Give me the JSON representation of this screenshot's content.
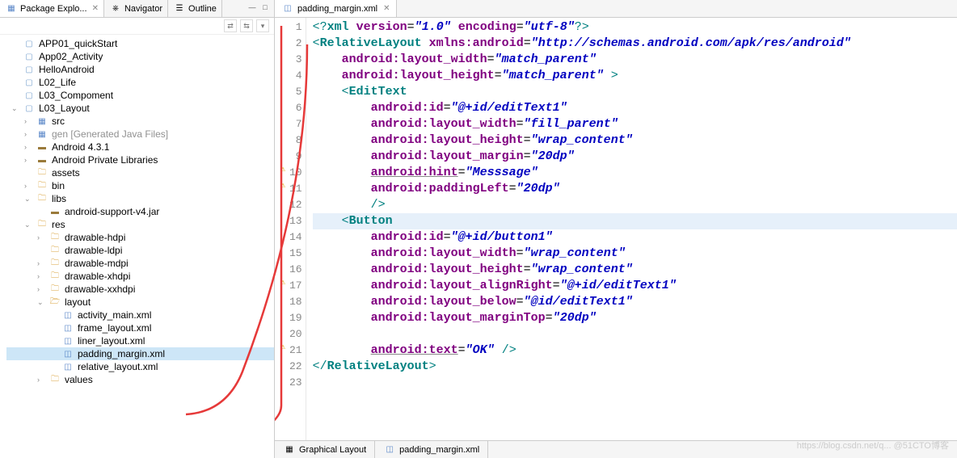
{
  "sideTabs": {
    "active": "Package Explo...",
    "tab2": "Navigator",
    "tab3": "Outline"
  },
  "tree": {
    "items": [
      {
        "ind": 0,
        "arrow": "",
        "icon": "proj",
        "label": "APP01_quickStart"
      },
      {
        "ind": 0,
        "arrow": "",
        "icon": "proj",
        "label": "App02_Activity"
      },
      {
        "ind": 0,
        "arrow": "",
        "icon": "proj",
        "label": "HelloAndroid"
      },
      {
        "ind": 0,
        "arrow": "",
        "icon": "proj",
        "label": "L02_Life"
      },
      {
        "ind": 0,
        "arrow": "",
        "icon": "proj",
        "label": "L03_Compoment"
      },
      {
        "ind": 0,
        "arrow": "v",
        "icon": "proj",
        "label": "L03_Layout"
      },
      {
        "ind": 1,
        "arrow": ">",
        "icon": "package",
        "label": "src"
      },
      {
        "ind": 1,
        "arrow": ">",
        "icon": "package",
        "label": "gen [Generated Java Files]",
        "gray": true
      },
      {
        "ind": 1,
        "arrow": ">",
        "icon": "jar",
        "label": "Android 4.3.1"
      },
      {
        "ind": 1,
        "arrow": ">",
        "icon": "jar",
        "label": "Android Private Libraries"
      },
      {
        "ind": 1,
        "arrow": "",
        "icon": "folder",
        "label": "assets"
      },
      {
        "ind": 1,
        "arrow": ">",
        "icon": "folder",
        "label": "bin"
      },
      {
        "ind": 1,
        "arrow": "v",
        "icon": "folder",
        "label": "libs"
      },
      {
        "ind": 2,
        "arrow": "",
        "icon": "jar",
        "label": "android-support-v4.jar"
      },
      {
        "ind": 1,
        "arrow": "v",
        "icon": "folder",
        "label": "res"
      },
      {
        "ind": 2,
        "arrow": ">",
        "icon": "folder",
        "label": "drawable-hdpi"
      },
      {
        "ind": 2,
        "arrow": "",
        "icon": "folder",
        "label": "drawable-ldpi"
      },
      {
        "ind": 2,
        "arrow": ">",
        "icon": "folder",
        "label": "drawable-mdpi"
      },
      {
        "ind": 2,
        "arrow": ">",
        "icon": "folder",
        "label": "drawable-xhdpi"
      },
      {
        "ind": 2,
        "arrow": ">",
        "icon": "folder",
        "label": "drawable-xxhdpi"
      },
      {
        "ind": 2,
        "arrow": "v",
        "icon": "folder-open",
        "label": "layout"
      },
      {
        "ind": 3,
        "arrow": "",
        "icon": "xml-file",
        "label": "activity_main.xml"
      },
      {
        "ind": 3,
        "arrow": "",
        "icon": "xml-file",
        "label": "frame_layout.xml"
      },
      {
        "ind": 3,
        "arrow": "",
        "icon": "xml-file",
        "label": "liner_layout.xml"
      },
      {
        "ind": 3,
        "arrow": "",
        "icon": "xml-file",
        "label": "padding_margin.xml",
        "selected": true
      },
      {
        "ind": 3,
        "arrow": "",
        "icon": "xml-file",
        "label": "relative_layout.xml"
      },
      {
        "ind": 2,
        "arrow": ">",
        "icon": "folder",
        "label": "values"
      }
    ]
  },
  "editor": {
    "tabTitle": "padding_margin.xml",
    "lines": 23,
    "markers": {
      "10": "⚠",
      "11": "⚠",
      "17": "⚠",
      "21": "⚠"
    }
  },
  "bottom": {
    "tab1": "Graphical Layout",
    "tab2": "padding_margin.xml"
  },
  "watermark": "https://blog.csdn.net/q... @51CTO博客"
}
